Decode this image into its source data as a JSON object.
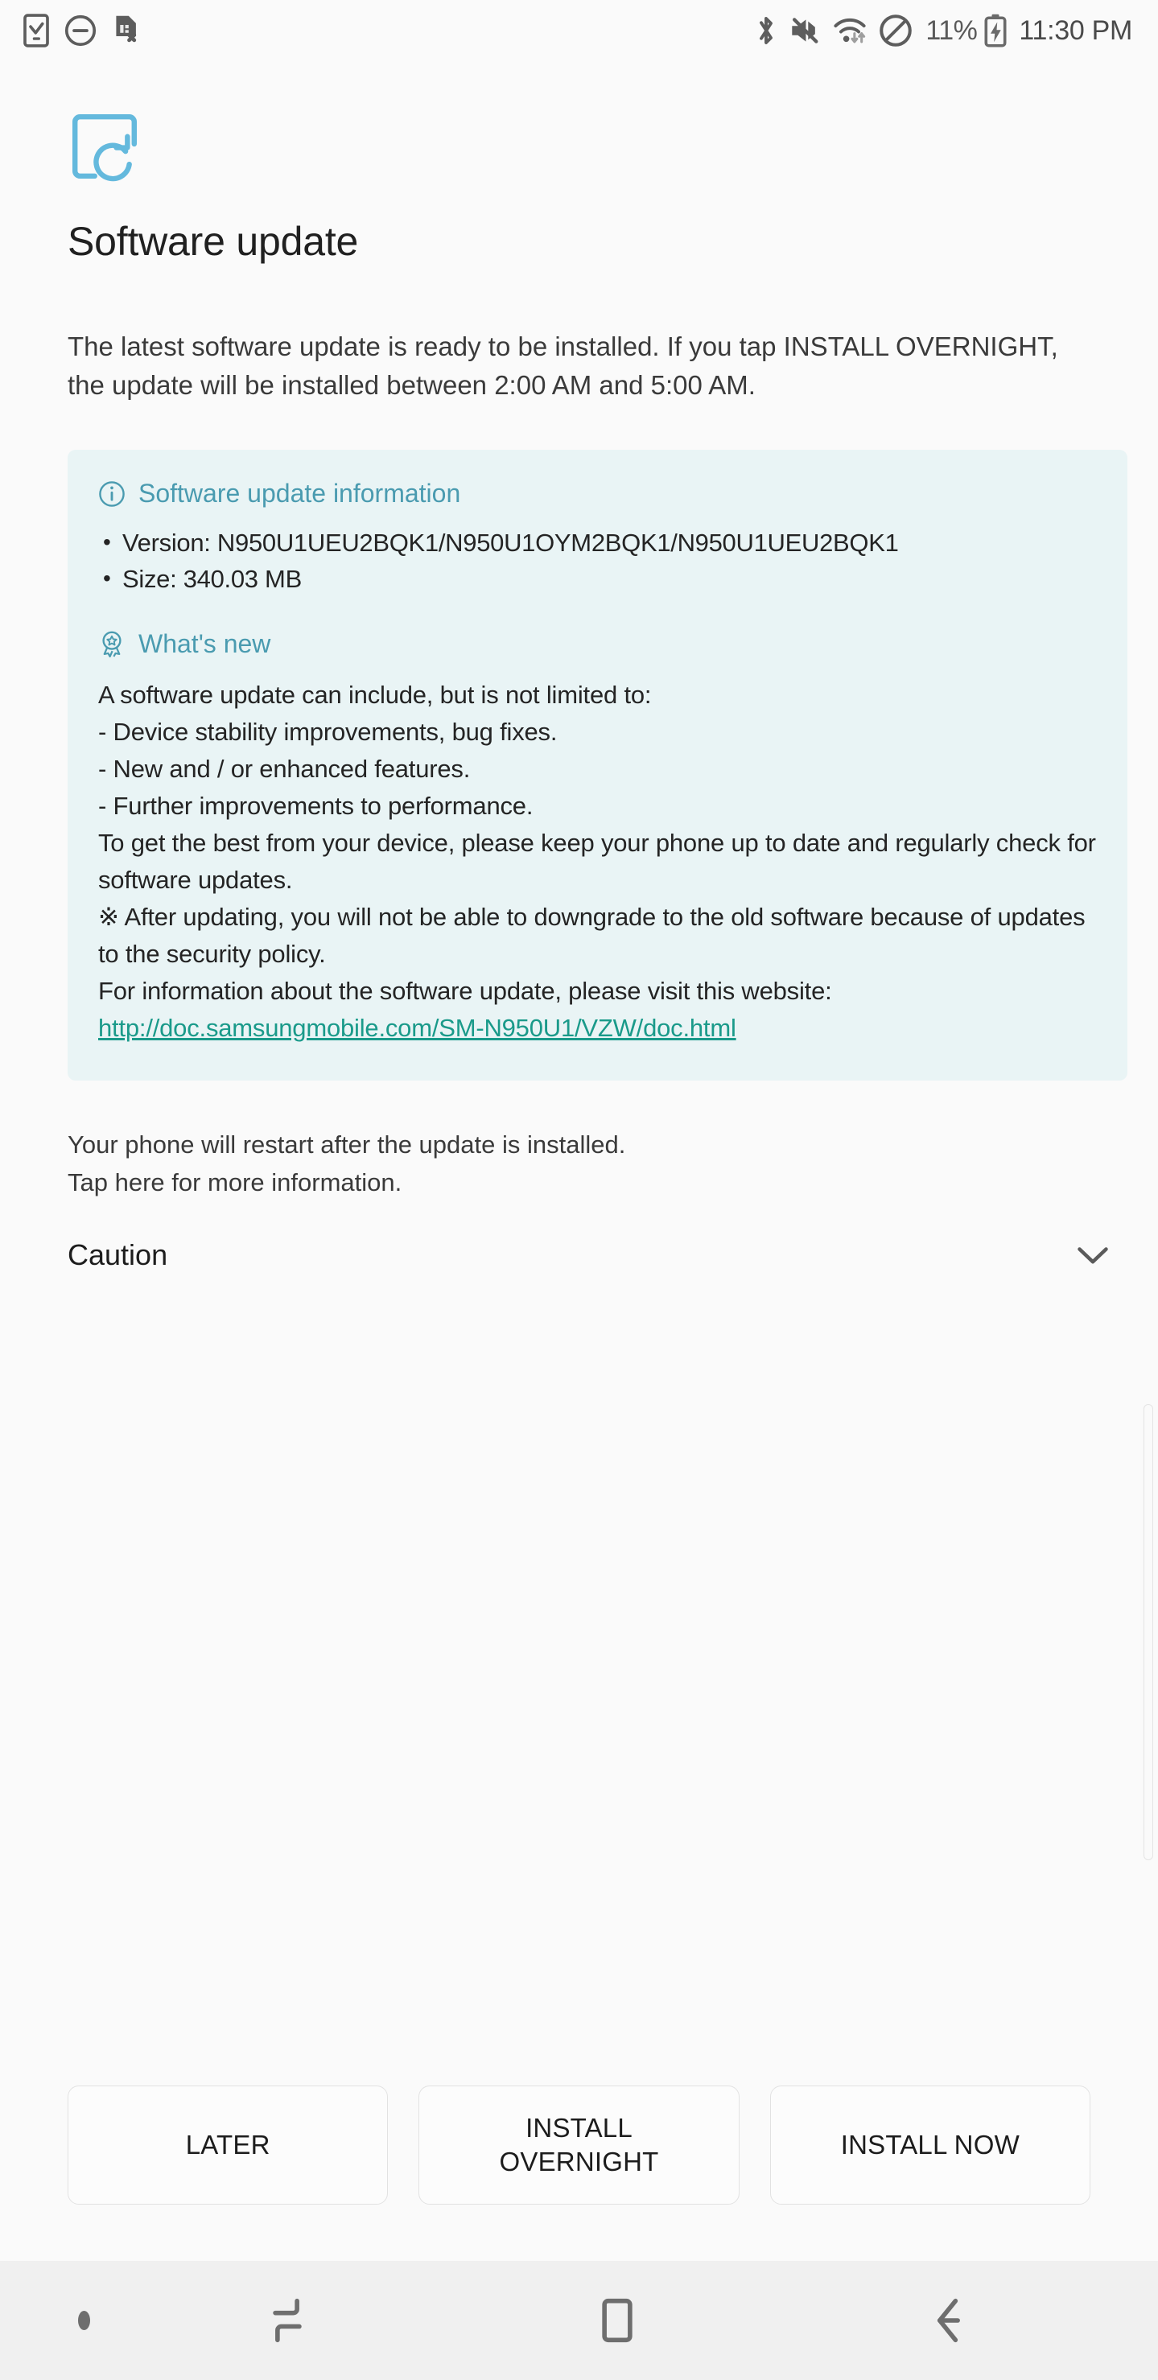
{
  "status_bar": {
    "left_icons": [
      {
        "name": "tasks-complete-icon",
        "label": "tasks"
      },
      {
        "name": "do-not-disturb-icon",
        "label": "do not disturb"
      },
      {
        "name": "no-sim-card-icon",
        "label": "no SIM"
      }
    ],
    "right_icons": [
      {
        "name": "bluetooth-icon",
        "label": "Bluetooth"
      },
      {
        "name": "mute-icon",
        "label": "Sound off"
      },
      {
        "name": "wifi-icon",
        "label": "Wi-Fi"
      },
      {
        "name": "blocked-icon",
        "label": "Blocking mode"
      }
    ],
    "battery_percent": "11%",
    "battery_state": "charging",
    "clock": "11:30 PM"
  },
  "app": {
    "icon_name": "software-update-icon",
    "icon_color": "#64b9dd",
    "title": "Software update"
  },
  "intro": "The latest software update is ready to be installed. If you tap INSTALL OVERNIGHT, the update will be installed between 2:00 AM and 5:00 AM.",
  "info_card": {
    "background": "#e9f4f5",
    "accent_color": "#4a9bb0",
    "update_info": {
      "icon_name": "info-circle-icon",
      "heading": "Software update information",
      "items": [
        "Version: N950U1UEU2BQK1/N950U1OYM2BQK1/N950U1UEU2BQK1",
        "Size: 340.03 MB"
      ]
    },
    "whats_new": {
      "icon_name": "award-badge-icon",
      "heading": "What's new",
      "body": "A software update can include, but is not limited to:\n - Device stability improvements, bug fixes.\n - New and / or enhanced features.\n - Further improvements to performance.\nTo get the best from your device, please keep your phone up to date and regularly check for software updates.\n※ After updating, you will not be able to downgrade to the old software because of updates to the security policy.\nFor information about the software update, please visit this website:",
      "link_text": "http://doc.samsungmobile.com/SM-N950U1/VZW/doc.html",
      "link_color": "#1a9a8a"
    }
  },
  "restart_note": "Your phone will restart after the update is installed.\nTap here for more information.",
  "caution": {
    "label": "Caution",
    "chevron_icon": "chevron-down-icon",
    "expanded": false
  },
  "buttons": {
    "later": "LATER",
    "install_overnight": "INSTALL\nOVERNIGHT",
    "install_now": "INSTALL NOW"
  },
  "nav_bar": {
    "dot": "•",
    "recents": "recents-icon",
    "home": "home-icon",
    "back": "back-icon"
  }
}
